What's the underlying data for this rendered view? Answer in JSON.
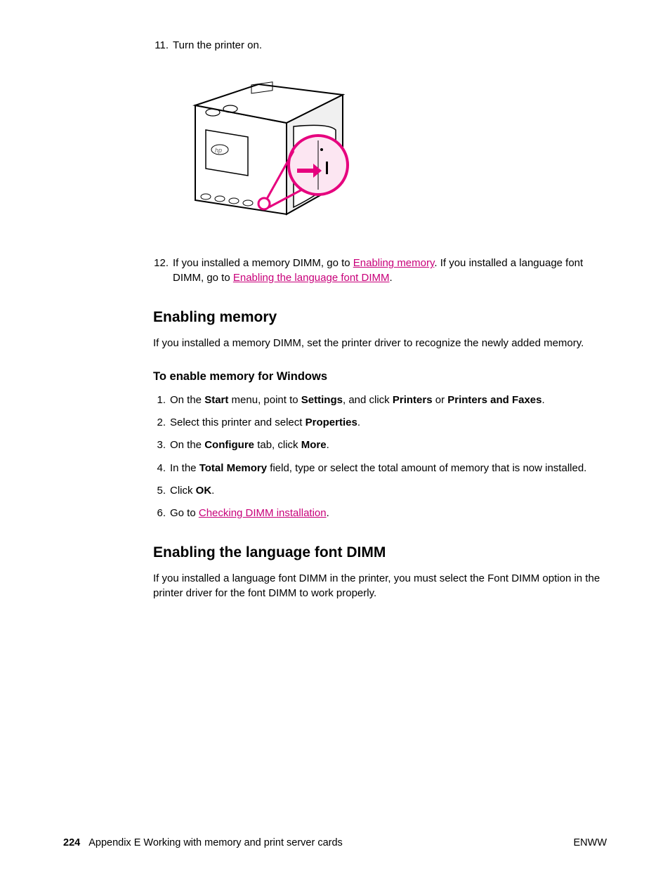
{
  "steps_top": [
    {
      "num": "11.",
      "text": "Turn the printer on."
    },
    {
      "num": "12.",
      "prefix": "If you installed a memory DIMM, go to ",
      "link1": "Enabling memory",
      "mid": ". If you installed a language font DIMM, go to ",
      "link2": "Enabling the language font DIMM",
      "suffix": "."
    }
  ],
  "section1": {
    "heading": "Enabling memory",
    "intro": "If you installed a memory DIMM, set the printer driver to recognize the newly added memory.",
    "subheading": "To enable memory for Windows",
    "steps": [
      {
        "num": "1.",
        "parts": [
          "On the ",
          "Start",
          " menu, point to ",
          "Settings",
          ", and click ",
          "Printers",
          " or ",
          "Printers and Faxes",
          "."
        ]
      },
      {
        "num": "2.",
        "parts": [
          "Select this printer and select ",
          "Properties",
          "."
        ]
      },
      {
        "num": "3.",
        "parts": [
          "On the ",
          "Configure",
          " tab, click ",
          "More",
          "."
        ]
      },
      {
        "num": "4.",
        "parts": [
          "In the ",
          "Total Memory",
          " field, type or select the total amount of memory that is now installed."
        ]
      },
      {
        "num": "5.",
        "parts": [
          "Click ",
          "OK",
          "."
        ]
      },
      {
        "num": "6.",
        "prefix": "Go to ",
        "link": "Checking DIMM installation",
        "suffix": "."
      }
    ]
  },
  "section2": {
    "heading": "Enabling the language font DIMM",
    "intro": "If you installed a language font DIMM in the printer, you must select the Font DIMM option in the printer driver for the font DIMM to work properly."
  },
  "footer": {
    "page": "224",
    "appendix": "Appendix E   Working with memory and print server cards",
    "lang": "ENWW"
  }
}
